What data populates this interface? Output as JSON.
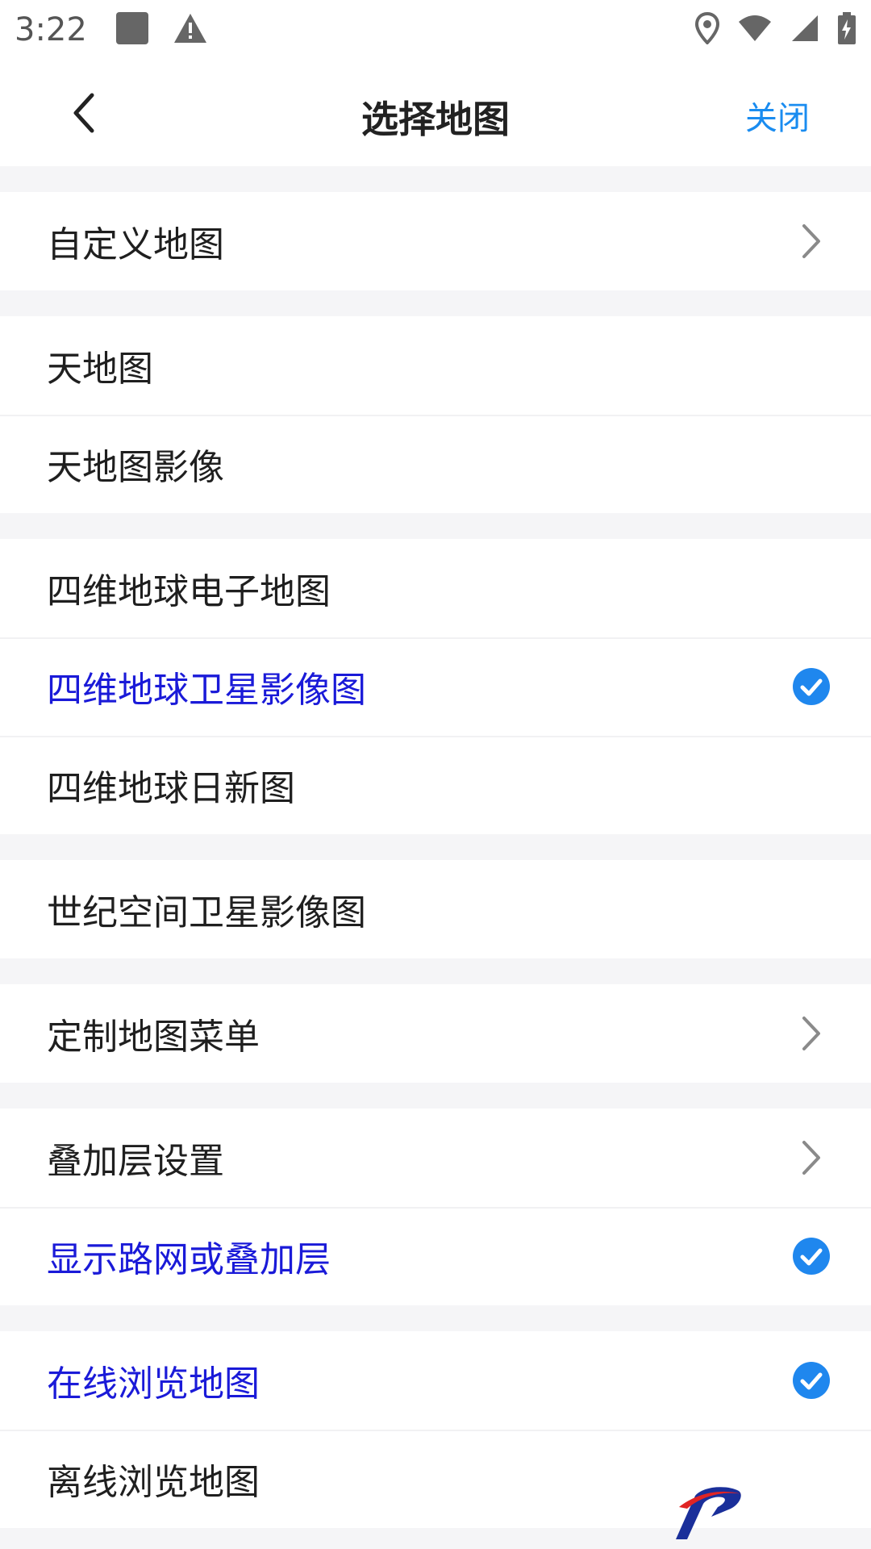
{
  "status_bar": {
    "time": "3:22",
    "left_icons": [
      "notification-square-icon",
      "warning-icon"
    ],
    "right_icons": [
      "location-icon",
      "wifi-icon",
      "cellular-signal-icon",
      "battery-charging-icon"
    ]
  },
  "header": {
    "title": "选择地图",
    "close_label": "关闭",
    "back_icon": "chevron-left-icon"
  },
  "colors": {
    "accent_link": "#1a8cf0",
    "selected_text": "#1a1ad8",
    "check_fill": "#1f87ee"
  },
  "groups": [
    {
      "items": [
        {
          "label": "自定义地图",
          "trail": "chevron",
          "selected": false
        }
      ]
    },
    {
      "items": [
        {
          "label": "天地图",
          "trail": "none",
          "selected": false
        },
        {
          "label": "天地图影像",
          "trail": "none",
          "selected": false
        }
      ]
    },
    {
      "items": [
        {
          "label": "四维地球电子地图",
          "trail": "none",
          "selected": false
        },
        {
          "label": "四维地球卫星影像图",
          "trail": "check",
          "selected": true
        },
        {
          "label": "四维地球日新图",
          "trail": "none",
          "selected": false
        }
      ]
    },
    {
      "items": [
        {
          "label": "世纪空间卫星影像图",
          "trail": "none",
          "selected": false
        }
      ]
    },
    {
      "items": [
        {
          "label": "定制地图菜单",
          "trail": "chevron",
          "selected": false
        }
      ]
    },
    {
      "items": [
        {
          "label": "叠加层设置",
          "trail": "chevron",
          "selected": false
        },
        {
          "label": "显示路网或叠加层",
          "trail": "check",
          "selected": true
        }
      ]
    },
    {
      "items": [
        {
          "label": "在线浏览地图",
          "trail": "check",
          "selected": true
        },
        {
          "label": "离线浏览地图",
          "trail": "none",
          "selected": false
        }
      ]
    }
  ]
}
